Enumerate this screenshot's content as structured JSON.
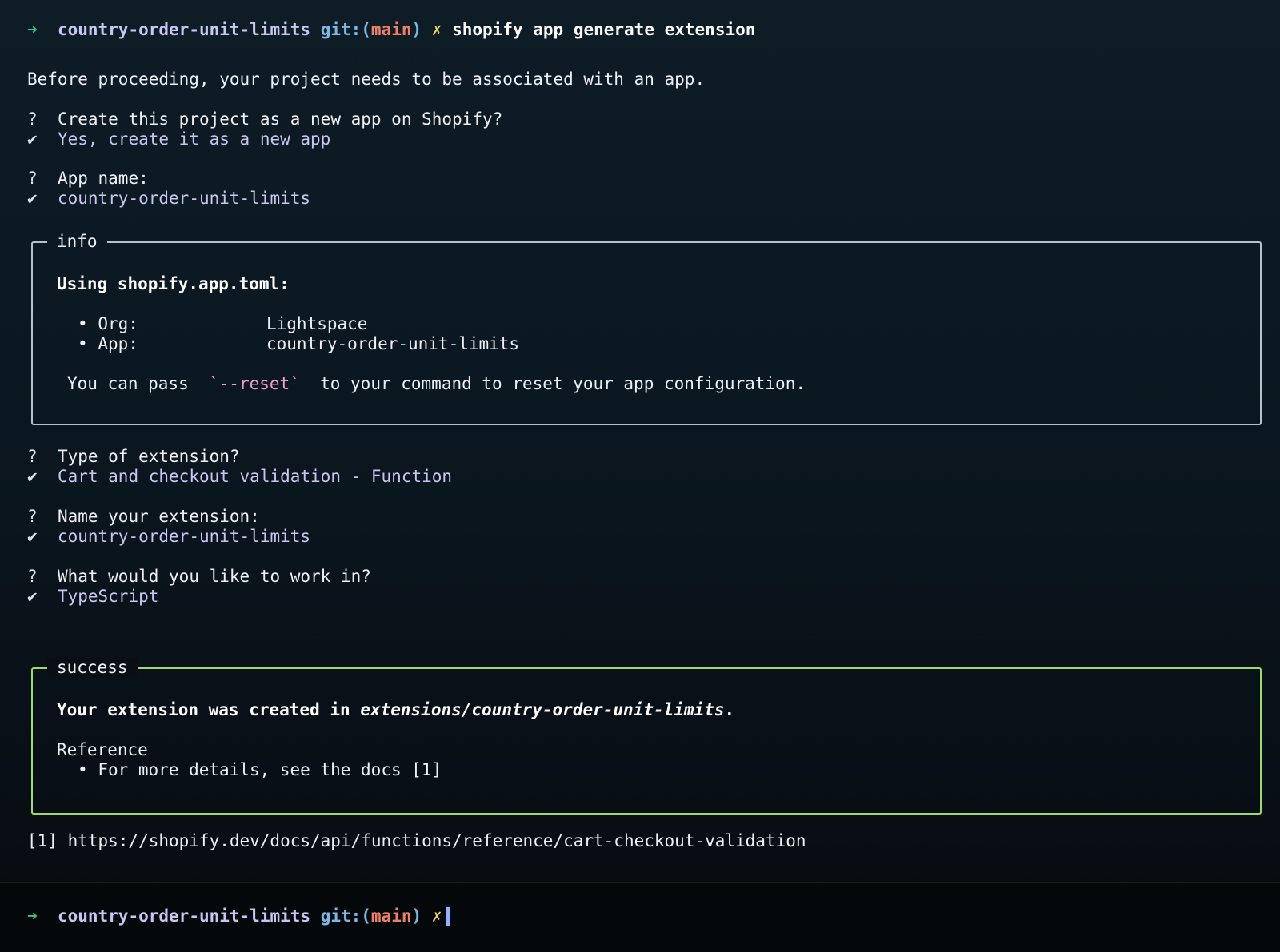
{
  "prompt": {
    "arrow": "➜",
    "dir": "country-order-unit-limits",
    "git_label": "git:(",
    "branch": "main",
    "git_close": ")",
    "dirty": "✗",
    "command": "shopify app generate extension"
  },
  "intro": "Before proceeding, your project needs to be associated with an app.",
  "questions": [
    {
      "q_mark": "?",
      "question": "Create this project as a new app on Shopify?",
      "check": "✔",
      "answer": "Yes, create it as a new app"
    },
    {
      "q_mark": "?",
      "question": "App name:",
      "check": "✔",
      "answer": "country-order-unit-limits"
    },
    {
      "q_mark": "?",
      "question": "Type of extension?",
      "check": "✔",
      "answer": "Cart and checkout validation - Function"
    },
    {
      "q_mark": "?",
      "question": "Name your extension:",
      "check": "✔",
      "answer": "country-order-unit-limits"
    },
    {
      "q_mark": "?",
      "question": "What would you like to work in?",
      "check": "✔",
      "answer": "TypeScript"
    }
  ],
  "info_box": {
    "title": "info",
    "heading": "Using shopify.app.toml:",
    "items": [
      {
        "bullet": "•",
        "key": "Org:",
        "value": "Lightspace"
      },
      {
        "bullet": "•",
        "key": "App:",
        "value": "country-order-unit-limits"
      }
    ],
    "hint_pre": "You can pass",
    "hint_flag": "`--reset`",
    "hint_post": "to your command to reset your app configuration."
  },
  "success_box": {
    "title": "success",
    "msg_pre": "Your extension was created in",
    "msg_path": "extensions/country-order-unit-limits",
    "msg_post": ".",
    "ref_label": "Reference",
    "ref_bullet": "•",
    "ref_item": "For more details, see the docs [1]"
  },
  "footnote": "[1] https://shopify.dev/docs/api/functions/reference/cart-checkout-validation",
  "final_prompt": {
    "arrow": "➜",
    "dir": "country-order-unit-limits",
    "git_label": "git:(",
    "branch": "main",
    "git_close": ")",
    "dirty": "✗"
  }
}
